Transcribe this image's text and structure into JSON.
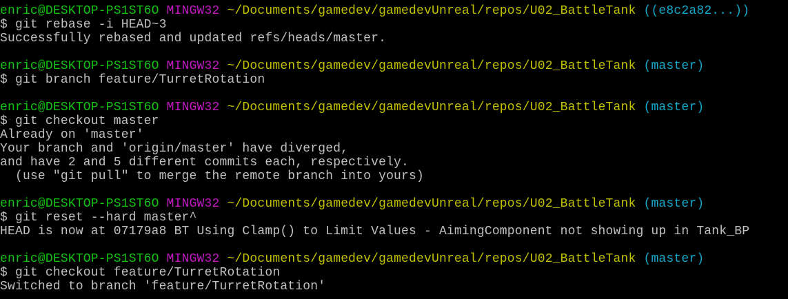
{
  "prompt": {
    "user_host": "enric@DESKTOP-PS1ST6O",
    "system": "MINGW32",
    "path": "~/Documents/gamedev/gamedevUnreal/repos/U02_BattleTank"
  },
  "colors": {
    "user": "#13c313",
    "system": "#c318c3",
    "path": "#c1c100",
    "branch": "#12a8c8",
    "text": "#c0c0c0",
    "background": "#000000"
  },
  "blocks": [
    {
      "branch": "((e8c2a82...))",
      "command": "$ git rebase -i HEAD~3",
      "output": [
        "Successfully rebased and updated refs/heads/master."
      ]
    },
    {
      "branch": "(master)",
      "command": "$ git branch feature/TurretRotation",
      "output": []
    },
    {
      "branch": "(master)",
      "command": "$ git checkout master",
      "output": [
        "Already on 'master'",
        "Your branch and 'origin/master' have diverged,",
        "and have 2 and 5 different commits each, respectively.",
        "  (use \"git pull\" to merge the remote branch into yours)"
      ]
    },
    {
      "branch": "(master)",
      "command": "$ git reset --hard master^",
      "output": [
        "HEAD is now at 07179a8 BT Using Clamp() to Limit Values - AimingComponent not showing up in Tank_BP"
      ]
    },
    {
      "branch": "(master)",
      "command": "$ git checkout feature/TurretRotation",
      "output": [
        "Switched to branch 'feature/TurretRotation'"
      ]
    }
  ]
}
